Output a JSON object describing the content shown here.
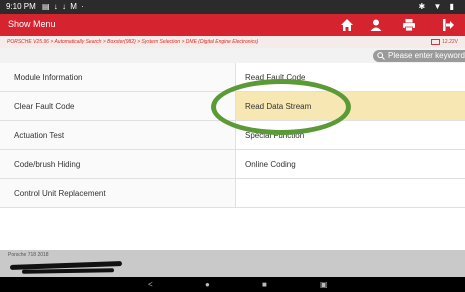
{
  "status_bar": {
    "time": "9:10 PM",
    "notifications": "▤ ↓ ↓ M ·",
    "system_icons": "✱ ▼ ▮"
  },
  "header": {
    "title": "Show Menu",
    "accent_color": "#d62330"
  },
  "breadcrumb": {
    "text": "PORSCHE V25.96 > Automatically Search > Boxster(982) > System Selection > DME (Digital Engine Electronics)",
    "voltage": "12.22V"
  },
  "search": {
    "placeholder": "Please enter keyword"
  },
  "menu": {
    "left": [
      {
        "label": "Module Information"
      },
      {
        "label": "Clear Fault Code"
      },
      {
        "label": "Actuation Test"
      },
      {
        "label": "Code/brush Hiding"
      },
      {
        "label": "Control Unit Replacement"
      }
    ],
    "right": [
      {
        "label": "Read Fault Code"
      },
      {
        "label": "Read Data Stream",
        "highlighted": true
      },
      {
        "label": "Special Function"
      },
      {
        "label": "Online Coding"
      },
      {
        "label": ""
      }
    ]
  },
  "footer": {
    "vehicle": "Porsche 718 2018"
  },
  "nav_bar": {
    "back": "<",
    "home": "●",
    "recent": "■",
    "screenshot": "▣"
  },
  "annotation": {
    "color": "#5b9a37",
    "shape": "ellipse"
  }
}
